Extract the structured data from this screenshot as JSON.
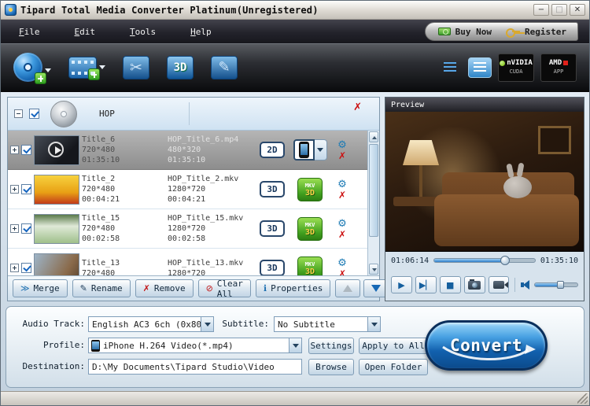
{
  "window": {
    "title": "Tipard Total Media Converter Platinum(Unregistered)",
    "controls": {
      "minimize": "−",
      "maximize": "□",
      "close": "✕"
    }
  },
  "menubar": {
    "items": [
      "File",
      "Edit",
      "Tools",
      "Help"
    ],
    "buy_now": "Buy Now",
    "register": "Register"
  },
  "toolbar": {
    "icons": [
      "load-dvd",
      "add-file",
      "clip",
      "3d-settings",
      "edit"
    ],
    "threed_icon_label": "3D",
    "nvidia_badge": {
      "brand": "nVIDIA",
      "sub": "CUDA"
    },
    "amd_badge": {
      "brand": "AMD",
      "sub": "APP"
    }
  },
  "file_list": {
    "disc_name": "HOP",
    "rows": [
      {
        "title": "Title_6",
        "resolution": "720*480",
        "duration": "01:35:10",
        "output_name": "HOP_Title_6.mp4",
        "output_resolution": "480*320",
        "output_duration": "01:35:10",
        "mode": "2D"
      },
      {
        "title": "Title_2",
        "resolution": "720*480",
        "duration": "00:04:21",
        "output_name": "HOP_Title_2.mkv",
        "output_resolution": "1280*720",
        "output_duration": "00:04:21",
        "mode": "3D"
      },
      {
        "title": "Title_15",
        "resolution": "720*480",
        "duration": "00:02:58",
        "output_name": "HOP_Title_15.mkv",
        "output_resolution": "1280*720",
        "output_duration": "00:02:58",
        "mode": "3D"
      },
      {
        "title": "Title_13",
        "resolution": "720*480",
        "duration": "",
        "output_name": "HOP_Title_13.mkv",
        "output_resolution": "1280*720",
        "output_duration": "",
        "mode": "3D"
      }
    ],
    "mkv_badge": {
      "label": "MKV",
      "sub": "3D"
    },
    "buttons": {
      "merge": "Merge",
      "rename": "Rename",
      "remove": "Remove",
      "clear_all": "Clear All",
      "properties": "Properties"
    }
  },
  "preview": {
    "label": "Preview",
    "elapsed": "01:06:14",
    "total": "01:35:10"
  },
  "settings_panel": {
    "audio_track_label": "Audio Track:",
    "audio_track_value": "English AC3 6ch (0x80",
    "subtitle_label": "Subtitle:",
    "subtitle_value": "No Subtitle",
    "profile_label": "Profile:",
    "profile_value": "iPhone H.264 Video(*.mp4)",
    "settings_button": "Settings",
    "apply_to_all_button": "Apply to All",
    "destination_label": "Destination:",
    "destination_value": "D:\\My Documents\\Tipard Studio\\Video",
    "browse_button": "Browse",
    "open_folder_button": "Open Folder",
    "convert_button": "Convert"
  },
  "colors": {
    "accent_blue": "#1f7fd1",
    "mkv_green": "#3f9e1e",
    "alert_red": "#cc1111"
  }
}
